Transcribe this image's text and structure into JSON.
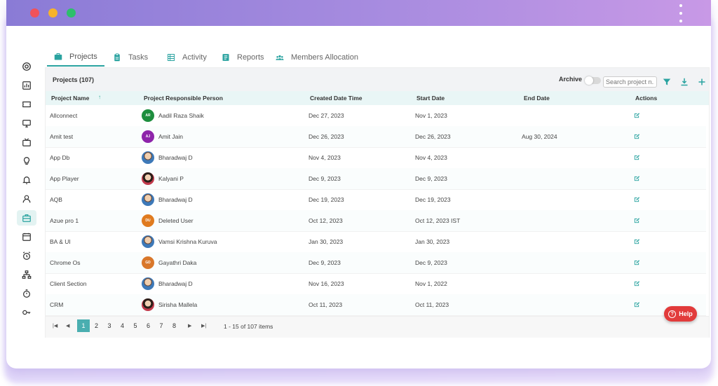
{
  "tabs": [
    {
      "label": "Projects",
      "icon": "briefcase-icon",
      "active": true
    },
    {
      "label": "Tasks",
      "icon": "clipboard-icon"
    },
    {
      "label": "Activity",
      "icon": "grid-icon"
    },
    {
      "label": "Reports",
      "icon": "report-icon"
    },
    {
      "label": "Members Allocation",
      "icon": "group-icon"
    }
  ],
  "panel": {
    "title": "Projects (107)",
    "archive_label": "Archive",
    "search_placeholder": "Search project n..."
  },
  "columns": {
    "name": "Project Name",
    "person": "Project Responsible Person",
    "created": "Created Date Time",
    "start": "Start Date",
    "end": "End Date",
    "actions": "Actions"
  },
  "rows": [
    {
      "name": "Allconnect",
      "person": "Aadil Raza Shaik",
      "initials": "AR",
      "avatar_color": "#1e8e3e",
      "created": "Dec 27, 2023",
      "start": "Nov 1, 2023",
      "end": ""
    },
    {
      "name": "Amit test",
      "person": "Amit Jain",
      "initials": "AJ",
      "avatar_color": "#8e24aa",
      "created": "Dec 26, 2023",
      "start": "Dec 26, 2023",
      "end": "Aug 30, 2024"
    },
    {
      "name": "App Db",
      "person": "Bharadwaj D",
      "initials": "",
      "avatar_color": "",
      "created": "Nov 4, 2023",
      "start": "Nov 4, 2023",
      "end": ""
    },
    {
      "name": "App Player",
      "person": "Kalyani P",
      "initials": "",
      "avatar_color": "",
      "created": "Dec 9, 2023",
      "start": "Dec 9, 2023",
      "end": ""
    },
    {
      "name": "AQB",
      "person": "Bharadwaj D",
      "initials": "",
      "avatar_color": "",
      "created": "Dec 19, 2023",
      "start": "Dec 19, 2023",
      "end": ""
    },
    {
      "name": "Azue pro 1",
      "person": "Deleted User",
      "initials": "DU",
      "avatar_color": "#e07b1f",
      "created": "Oct 12, 2023",
      "start": "Oct 12, 2023 IST",
      "end": ""
    },
    {
      "name": "BA & UI",
      "person": "Vamsi Krishna Kuruva",
      "initials": "",
      "avatar_color": "",
      "created": "Jan 30, 2023",
      "start": "Jan 30, 2023",
      "end": ""
    },
    {
      "name": "Chrome Os",
      "person": "Gayathri Daka",
      "initials": "GD",
      "avatar_color": "#d9772a",
      "created": "Dec 9, 2023",
      "start": "Dec 9, 2023",
      "end": ""
    },
    {
      "name": "Client Section",
      "person": "Bharadwaj D",
      "initials": "",
      "avatar_color": "",
      "created": "Nov 16, 2023",
      "start": "Nov 1, 2022",
      "end": ""
    },
    {
      "name": "CRM",
      "person": "Sirisha Mallela",
      "initials": "",
      "avatar_color": "",
      "created": "Oct 11, 2023",
      "start": "Oct 11, 2023",
      "end": ""
    }
  ],
  "pagination": {
    "pages": [
      "1",
      "2",
      "3",
      "4",
      "5",
      "6",
      "7",
      "8"
    ],
    "current": "1",
    "info": "1 - 15 of 107 items"
  },
  "help_label": "Help",
  "colors": {
    "accent": "#2aa3a0",
    "help": "#e23b3b"
  }
}
